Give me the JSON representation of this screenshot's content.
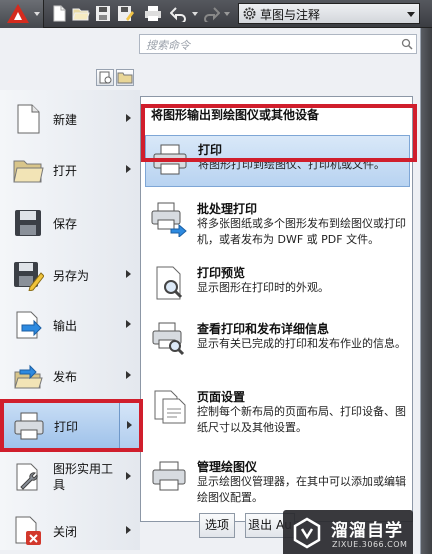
{
  "toolbar": {
    "workspace_label": "草图与注释",
    "quick_access_icons": [
      "new-icon",
      "open-icon",
      "save-icon",
      "saveas-icon",
      "print-icon",
      "undo-icon",
      "redo-icon"
    ]
  },
  "search": {
    "placeholder": "搜索命令"
  },
  "left_menu": {
    "items": [
      {
        "label": "新建",
        "icon": "new-file-icon",
        "has_arrow": true
      },
      {
        "label": "打开",
        "icon": "open-folder-icon",
        "has_arrow": true
      },
      {
        "label": "保存",
        "icon": "floppy-disk-icon",
        "has_arrow": false
      },
      {
        "label": "另存为",
        "icon": "save-as-icon",
        "has_arrow": true
      },
      {
        "label": "输出",
        "icon": "export-icon",
        "has_arrow": true
      },
      {
        "label": "发布",
        "icon": "publish-icon",
        "has_arrow": true
      },
      {
        "label": "打印",
        "icon": "printer-icon",
        "has_arrow": true,
        "active": true
      },
      {
        "label": "图形实用工具",
        "icon": "wrench-icon",
        "has_arrow": true
      },
      {
        "label": "关闭",
        "icon": "close-file-icon",
        "has_arrow": true
      }
    ]
  },
  "submenu": {
    "header": "将图形输出到绘图仪或其他设备",
    "items": [
      {
        "title": "打印",
        "desc": "将图形打印到绘图仪、打印机或文件。",
        "icon": "printer-icon",
        "active": true
      },
      {
        "title": "批处理打印",
        "desc": "将多张图纸或多个图形发布到绘图仪或打印机，或者发布为 DWF 或 PDF 文件。",
        "icon": "batch-plot-icon"
      },
      {
        "title": "打印预览",
        "desc": "显示图形在打印时的外观。",
        "icon": "plot-preview-icon"
      },
      {
        "title": "查看打印和发布详细信息",
        "desc": "显示有关已完成的打印和发布作业的信息。",
        "icon": "plot-details-icon"
      },
      {
        "title": "页面设置",
        "desc": "控制每个新布局的页面布局、打印设备、图纸尺寸以及其他设置。",
        "icon": "page-setup-icon"
      },
      {
        "title": "管理绘图仪",
        "desc": "显示绘图仪管理器，在其中可以添加或编辑绘图仪配置。",
        "icon": "plotter-manager-icon"
      }
    ]
  },
  "buttons": {
    "options": "选项",
    "exit": "退出 Au"
  },
  "watermark": {
    "name": "溜溜自学",
    "url": "ZIXUE.3066.COM"
  },
  "colors": {
    "highlight_frame": "#d01e2c",
    "selection_blue": "#b8d3f1",
    "app_logo_red": "#d42b1e"
  }
}
